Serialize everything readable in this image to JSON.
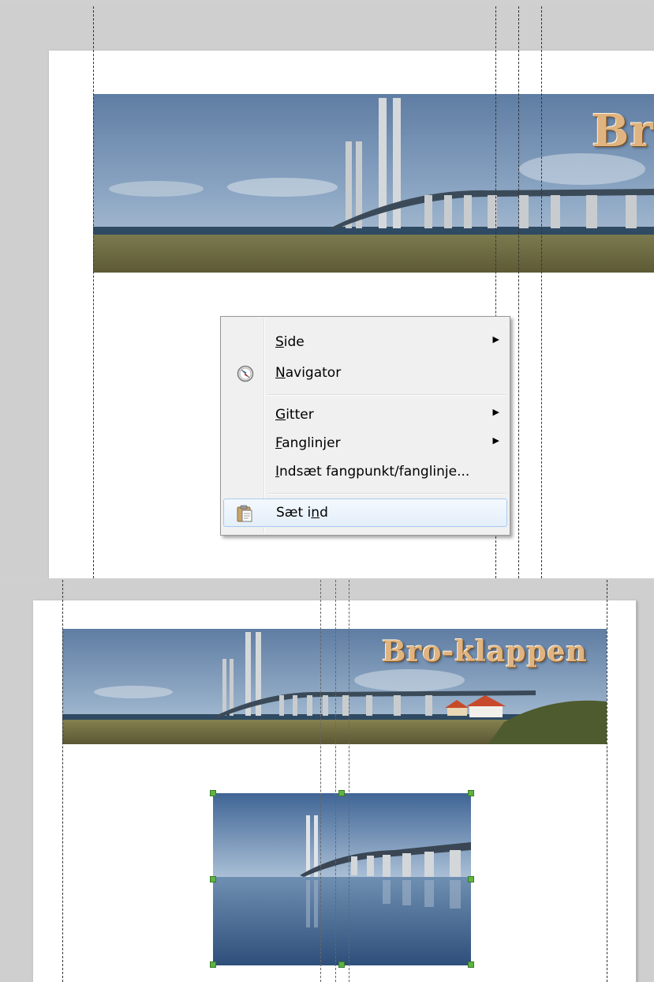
{
  "context_menu": {
    "items": [
      {
        "label": "Side",
        "mnemonic": "S",
        "submenu": true
      },
      {
        "label": "Navigator",
        "mnemonic": "N",
        "icon": "navigator-compass-icon"
      },
      {
        "label": "Gitter",
        "mnemonic": "G",
        "submenu": true
      },
      {
        "label": "Fanglinjer",
        "mnemonic": "F",
        "submenu": true
      },
      {
        "label": "Indsæt fangpunkt/fanglinje...",
        "mnemonic": "I"
      },
      {
        "label": "Sæt ind",
        "mnemonic": "n",
        "icon": "paste-clipboard-icon",
        "highlighted": true
      }
    ]
  },
  "banner": {
    "title": "Bro-klappen",
    "title_partial": "Br",
    "title_color": "#e0b480"
  },
  "colors": {
    "menu_background": "#f0f0f0",
    "menu_highlight_border": "#a8cbef",
    "selection_handle": "#5fb342",
    "workspace_background": "#cfcfcf"
  }
}
